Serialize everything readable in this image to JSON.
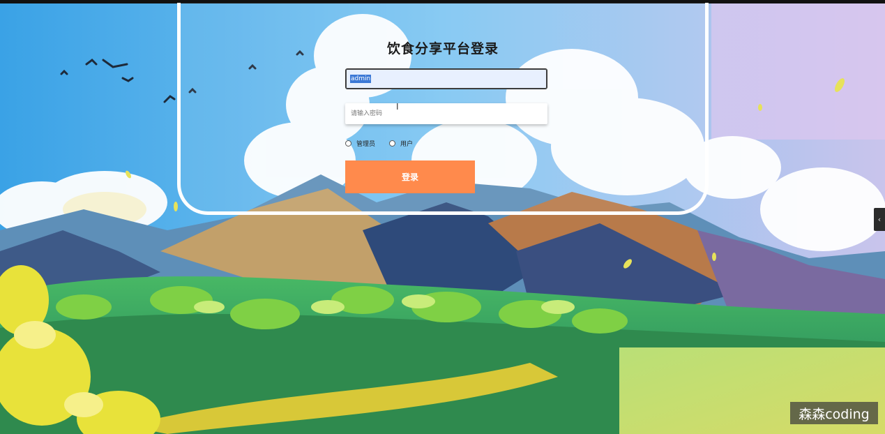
{
  "login": {
    "title": "饮食分享平台登录",
    "username_value": "admin",
    "password_placeholder": "请输入密码",
    "roles": [
      "管理员",
      "用户"
    ],
    "submit_label": "登录"
  },
  "side_toggle_icon": "chevron-left-icon",
  "side_toggle_glyph": "‹",
  "watermark": "森森coding",
  "colors": {
    "button": "#ff8a4c",
    "sky": "#5fb6ec",
    "input_bg": "#e8f0fe"
  }
}
